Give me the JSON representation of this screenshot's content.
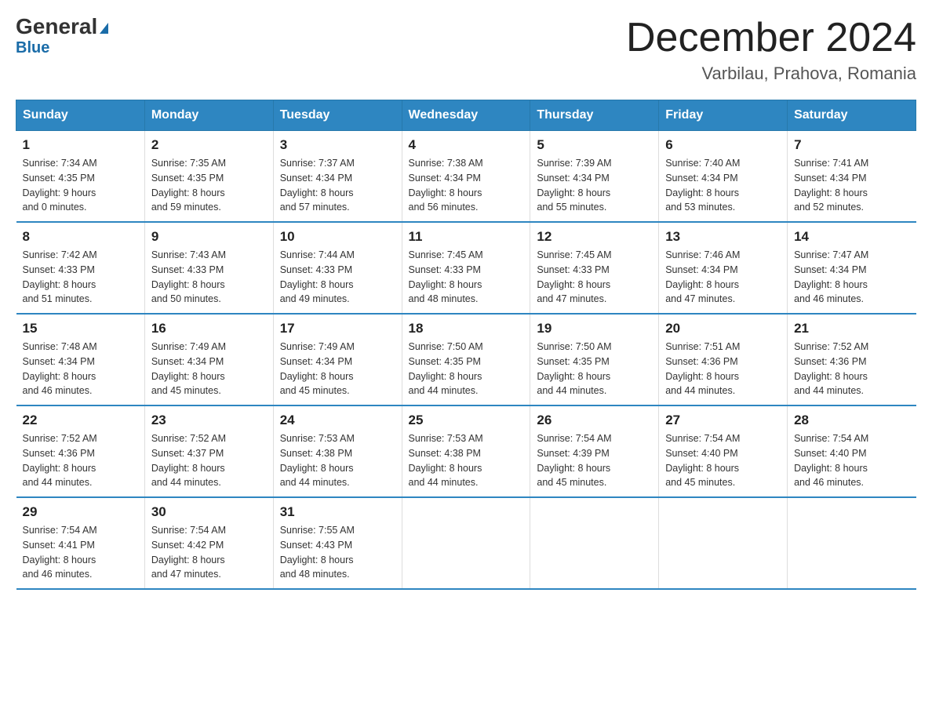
{
  "header": {
    "logo_general": "General",
    "logo_blue": "Blue",
    "month": "December 2024",
    "location": "Varbilau, Prahova, Romania"
  },
  "days_of_week": [
    "Sunday",
    "Monday",
    "Tuesday",
    "Wednesday",
    "Thursday",
    "Friday",
    "Saturday"
  ],
  "weeks": [
    [
      {
        "day": "1",
        "sunrise": "7:34 AM",
        "sunset": "4:35 PM",
        "daylight": "9 hours and 0 minutes."
      },
      {
        "day": "2",
        "sunrise": "7:35 AM",
        "sunset": "4:35 PM",
        "daylight": "8 hours and 59 minutes."
      },
      {
        "day": "3",
        "sunrise": "7:37 AM",
        "sunset": "4:34 PM",
        "daylight": "8 hours and 57 minutes."
      },
      {
        "day": "4",
        "sunrise": "7:38 AM",
        "sunset": "4:34 PM",
        "daylight": "8 hours and 56 minutes."
      },
      {
        "day": "5",
        "sunrise": "7:39 AM",
        "sunset": "4:34 PM",
        "daylight": "8 hours and 55 minutes."
      },
      {
        "day": "6",
        "sunrise": "7:40 AM",
        "sunset": "4:34 PM",
        "daylight": "8 hours and 53 minutes."
      },
      {
        "day": "7",
        "sunrise": "7:41 AM",
        "sunset": "4:34 PM",
        "daylight": "8 hours and 52 minutes."
      }
    ],
    [
      {
        "day": "8",
        "sunrise": "7:42 AM",
        "sunset": "4:33 PM",
        "daylight": "8 hours and 51 minutes."
      },
      {
        "day": "9",
        "sunrise": "7:43 AM",
        "sunset": "4:33 PM",
        "daylight": "8 hours and 50 minutes."
      },
      {
        "day": "10",
        "sunrise": "7:44 AM",
        "sunset": "4:33 PM",
        "daylight": "8 hours and 49 minutes."
      },
      {
        "day": "11",
        "sunrise": "7:45 AM",
        "sunset": "4:33 PM",
        "daylight": "8 hours and 48 minutes."
      },
      {
        "day": "12",
        "sunrise": "7:45 AM",
        "sunset": "4:33 PM",
        "daylight": "8 hours and 47 minutes."
      },
      {
        "day": "13",
        "sunrise": "7:46 AM",
        "sunset": "4:34 PM",
        "daylight": "8 hours and 47 minutes."
      },
      {
        "day": "14",
        "sunrise": "7:47 AM",
        "sunset": "4:34 PM",
        "daylight": "8 hours and 46 minutes."
      }
    ],
    [
      {
        "day": "15",
        "sunrise": "7:48 AM",
        "sunset": "4:34 PM",
        "daylight": "8 hours and 46 minutes."
      },
      {
        "day": "16",
        "sunrise": "7:49 AM",
        "sunset": "4:34 PM",
        "daylight": "8 hours and 45 minutes."
      },
      {
        "day": "17",
        "sunrise": "7:49 AM",
        "sunset": "4:34 PM",
        "daylight": "8 hours and 45 minutes."
      },
      {
        "day": "18",
        "sunrise": "7:50 AM",
        "sunset": "4:35 PM",
        "daylight": "8 hours and 44 minutes."
      },
      {
        "day": "19",
        "sunrise": "7:50 AM",
        "sunset": "4:35 PM",
        "daylight": "8 hours and 44 minutes."
      },
      {
        "day": "20",
        "sunrise": "7:51 AM",
        "sunset": "4:36 PM",
        "daylight": "8 hours and 44 minutes."
      },
      {
        "day": "21",
        "sunrise": "7:52 AM",
        "sunset": "4:36 PM",
        "daylight": "8 hours and 44 minutes."
      }
    ],
    [
      {
        "day": "22",
        "sunrise": "7:52 AM",
        "sunset": "4:36 PM",
        "daylight": "8 hours and 44 minutes."
      },
      {
        "day": "23",
        "sunrise": "7:52 AM",
        "sunset": "4:37 PM",
        "daylight": "8 hours and 44 minutes."
      },
      {
        "day": "24",
        "sunrise": "7:53 AM",
        "sunset": "4:38 PM",
        "daylight": "8 hours and 44 minutes."
      },
      {
        "day": "25",
        "sunrise": "7:53 AM",
        "sunset": "4:38 PM",
        "daylight": "8 hours and 44 minutes."
      },
      {
        "day": "26",
        "sunrise": "7:54 AM",
        "sunset": "4:39 PM",
        "daylight": "8 hours and 45 minutes."
      },
      {
        "day": "27",
        "sunrise": "7:54 AM",
        "sunset": "4:40 PM",
        "daylight": "8 hours and 45 minutes."
      },
      {
        "day": "28",
        "sunrise": "7:54 AM",
        "sunset": "4:40 PM",
        "daylight": "8 hours and 46 minutes."
      }
    ],
    [
      {
        "day": "29",
        "sunrise": "7:54 AM",
        "sunset": "4:41 PM",
        "daylight": "8 hours and 46 minutes."
      },
      {
        "day": "30",
        "sunrise": "7:54 AM",
        "sunset": "4:42 PM",
        "daylight": "8 hours and 47 minutes."
      },
      {
        "day": "31",
        "sunrise": "7:55 AM",
        "sunset": "4:43 PM",
        "daylight": "8 hours and 48 minutes."
      },
      null,
      null,
      null,
      null
    ]
  ],
  "labels": {
    "sunrise": "Sunrise:",
    "sunset": "Sunset:",
    "daylight": "Daylight:"
  }
}
